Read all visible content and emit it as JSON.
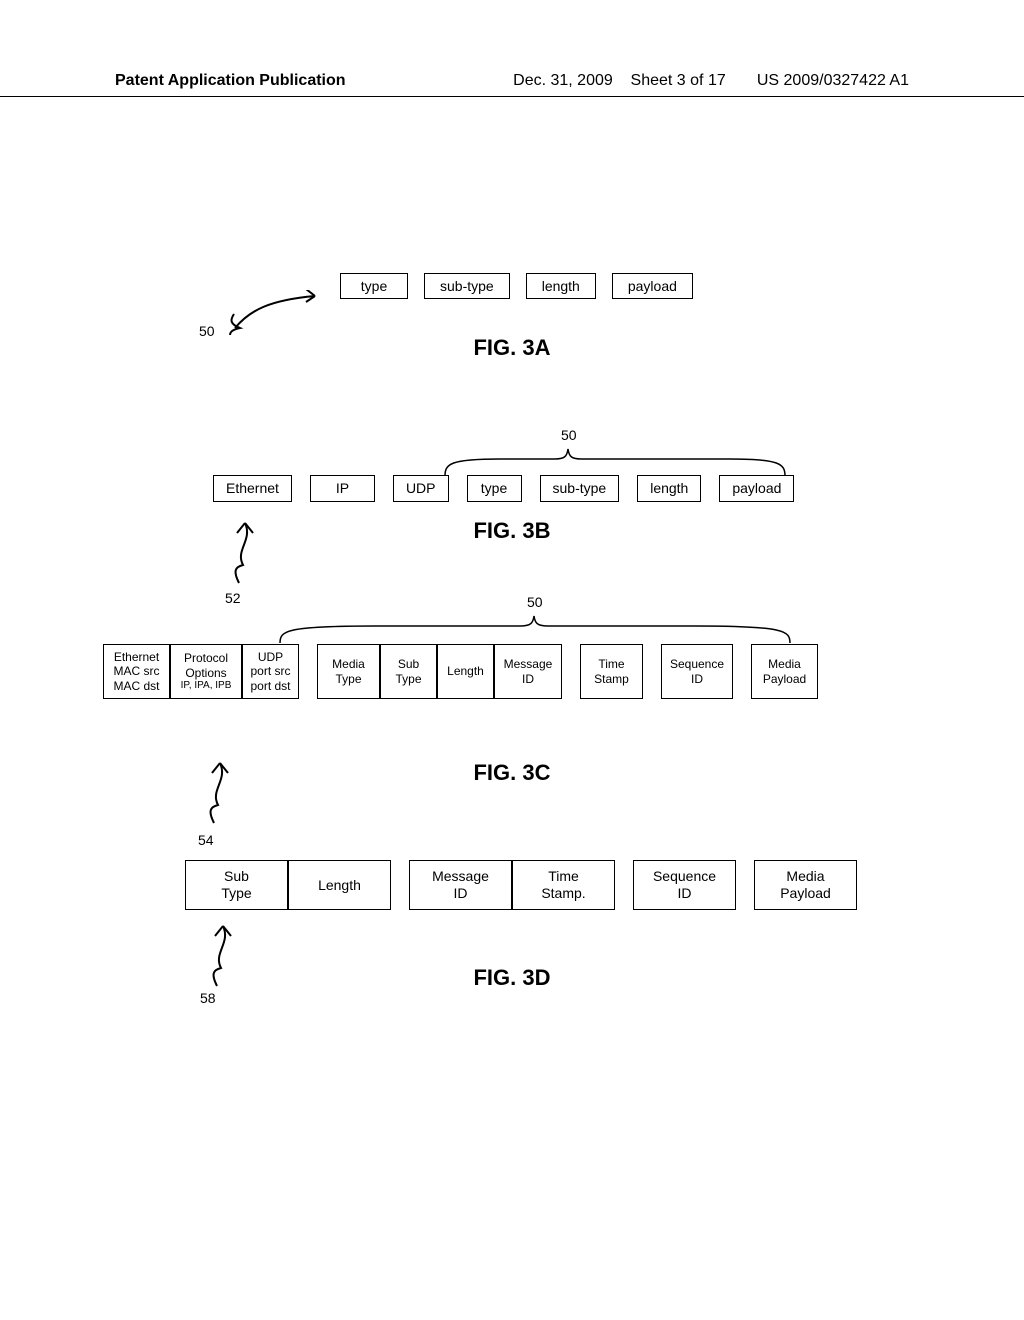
{
  "header": {
    "left": "Patent Application Publication",
    "date": "Dec. 31, 2009",
    "sheet": "Sheet 3 of 17",
    "pubno": "US 2009/0327422 A1"
  },
  "fig3a": {
    "cells": [
      "type",
      "sub-type",
      "length",
      "payload"
    ],
    "label": "FIG. 3A",
    "ref": "50"
  },
  "fig3b": {
    "cells": [
      "Ethernet",
      "IP",
      "UDP",
      "type",
      "sub-type",
      "length",
      "payload"
    ],
    "label": "FIG. 3B",
    "ref50": "50",
    "ref52": "52"
  },
  "fig3c": {
    "cells": [
      {
        "l1": "Ethernet",
        "l2": "MAC src",
        "l3": "MAC dst"
      },
      {
        "l1": "Protocol",
        "l2": "Options",
        "l3": "IP, IPA, IPB"
      },
      {
        "l1": "UDP",
        "l2": "port src",
        "l3": "port dst"
      },
      {
        "l1": "Media",
        "l2": "Type",
        "l3": ""
      },
      {
        "l1": "Sub",
        "l2": "Type",
        "l3": ""
      },
      {
        "l1": "Length",
        "l2": "",
        "l3": ""
      },
      {
        "l1": "Message",
        "l2": "ID",
        "l3": ""
      },
      {
        "l1": "Time",
        "l2": "Stamp",
        "l3": ""
      },
      {
        "l1": "Sequence",
        "l2": "ID",
        "l3": ""
      },
      {
        "l1": "Media",
        "l2": "Payload",
        "l3": ""
      }
    ],
    "label": "FIG. 3C",
    "ref50": "50",
    "ref54": "54"
  },
  "fig3d": {
    "cells": [
      {
        "l1": "Sub",
        "l2": "Type"
      },
      {
        "l1": "Length",
        "l2": ""
      },
      {
        "l1": "Message",
        "l2": "ID"
      },
      {
        "l1": "Time",
        "l2": "Stamp."
      },
      {
        "l1": "Sequence",
        "l2": "ID"
      },
      {
        "l1": "Media",
        "l2": "Payload"
      }
    ],
    "label": "FIG. 3D",
    "ref58": "58"
  }
}
